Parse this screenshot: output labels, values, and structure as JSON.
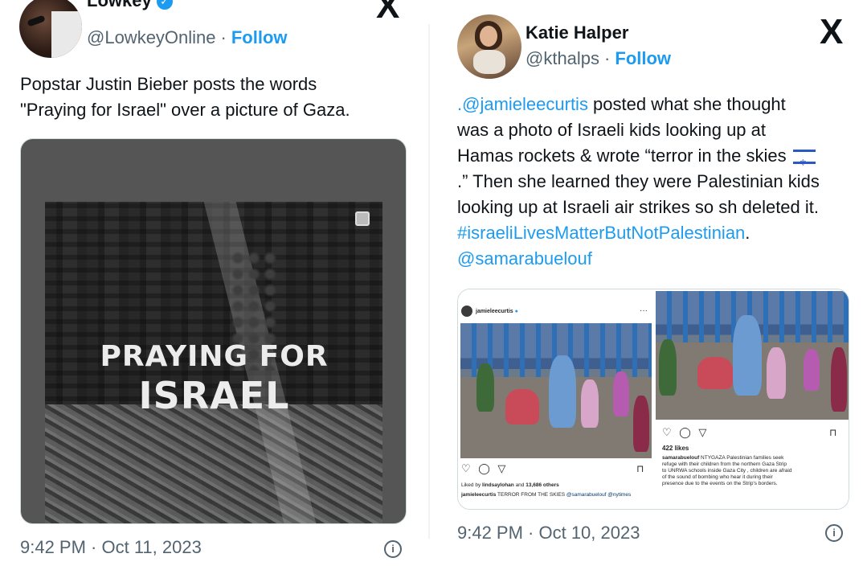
{
  "left_tweet": {
    "display_name": "Lowkey",
    "handle": "@LowkeyOnline",
    "follow_label": "Follow",
    "dot": "·",
    "x_logo": "X",
    "text_line1": "Popstar Justin Bieber posts the words",
    "text_line2": "\"Praying for Israel\" over a picture of Gaza.",
    "overlay_line1": "PRAYING FOR",
    "overlay_line2": "ISRAEL",
    "timestamp": "9:42 PM · Oct 11, 2023",
    "info_icon": "i"
  },
  "right_tweet": {
    "display_name": "Katie Halper",
    "handle": "@kthalps",
    "follow_label": "Follow",
    "dot": "·",
    "x_logo": "X",
    "mention": ".@jamieleecurtis",
    "text_part1": " posted what she thought",
    "text_line2": "was a photo of Israeli kids looking up at",
    "text_line3": "Hamas rockets & wrote “terror in the skies",
    "text_line4": ".” Then she learned they were Palestinian kids",
    "text_line5": "looking up at Israeli air strikes so sh deleted it.",
    "hashtag": "#israeliLivesMatterButNotPalestinian",
    "hashtag_suffix": ".",
    "mention2": "@samarabuelouf",
    "timestamp": "9:42 PM · Oct 10, 2023",
    "info_icon": "i",
    "ig_left": {
      "username": "jamieleecurtis",
      "more": "···",
      "action_icons": "♡ ◯ ▽",
      "save_icon": "⊓",
      "liked_by_prefix": "Liked by ",
      "liked_by_user": "lindsaylohan",
      "liked_by_middle": " and ",
      "liked_by_count": "13,686 others",
      "caption_user": "jamieleecurtis",
      "caption_text": " TERROR FROM THE SKIES ",
      "caption_tags": "@samarabuelouf @nytimes"
    },
    "ig_right": {
      "action_icons": "♡ ◯ ▽",
      "save_icon": "⊓",
      "likes": "422 likes",
      "caption_user": "samarabuelouf",
      "caption_line1": " NTYGAZA Palestinian families seek",
      "caption_line2": "refuge with their children from the northern Gaza Strip",
      "caption_line3": "to UNRWA schools inside Gaza City , children are afraid",
      "caption_line4": "of the sound of bombing who hear it during their",
      "caption_line5": "presence due to the events on the Strip's borders."
    }
  },
  "colors": {
    "link": "#1d9bf0",
    "text": "#0f1419",
    "muted": "#536471",
    "border": "#cfd9de"
  },
  "icons": {
    "verified": "verified-badge-icon",
    "x_logo": "x-logo-icon",
    "info": "info-icon",
    "multi_image": "multiple-images-icon",
    "flag": "israel-flag-emoji-icon"
  }
}
